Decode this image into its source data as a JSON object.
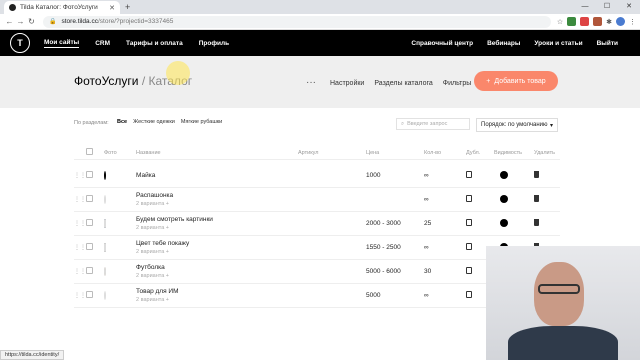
{
  "browser": {
    "tab_title": "Tilda Каталог: ФотоУслуги",
    "url_host": "store.tilda.cc",
    "url_path": "/store/?projectid=3337465"
  },
  "nav": {
    "logo": "T",
    "left": [
      "Мои сайты",
      "CRM",
      "Тарифы и оплата",
      "Профиль"
    ],
    "right": [
      "Справочный центр",
      "Вебинары",
      "Уроки и статьи",
      "Выйти"
    ]
  },
  "header": {
    "title": "ФотоУслуги",
    "separator": " / ",
    "subtitle": "Каталог",
    "links": [
      "Настройки",
      "Разделы каталога",
      "Фильтры"
    ],
    "add_button": "Добавить товар",
    "more": "···"
  },
  "filters": {
    "label": "По разделам:",
    "chips": [
      "Все",
      "Жесткие одежки",
      "Мягкие рубашки"
    ],
    "search_placeholder": "Введите запрос",
    "sort_value": "Порядок: по умолчанию"
  },
  "table": {
    "columns": [
      "Фото",
      "Название",
      "Артикул",
      "Цена",
      "Кол-во",
      "Дубл.",
      "Видимость",
      "Удалить"
    ],
    "rows": [
      {
        "name": "Майка",
        "variants": "",
        "price": "1000",
        "qty": "∞"
      },
      {
        "name": "Распашонка",
        "variants": "2 варианта +",
        "price": "",
        "qty": "∞"
      },
      {
        "name": "Будем смотреть картинки",
        "variants": "2 варианта +",
        "price": "2000 - 3000",
        "qty": "25"
      },
      {
        "name": "Цвет тебе покажу",
        "variants": "2 варианта +",
        "price": "1550 - 2500",
        "qty": "∞"
      },
      {
        "name": "Футболка",
        "variants": "2 варианта +",
        "price": "5000 - 6000",
        "qty": "30"
      },
      {
        "name": "Товар для ИМ",
        "variants": "2 варианта +",
        "price": "5000",
        "qty": "∞"
      }
    ]
  },
  "status_url": "https://tilda.cc/identity/"
}
